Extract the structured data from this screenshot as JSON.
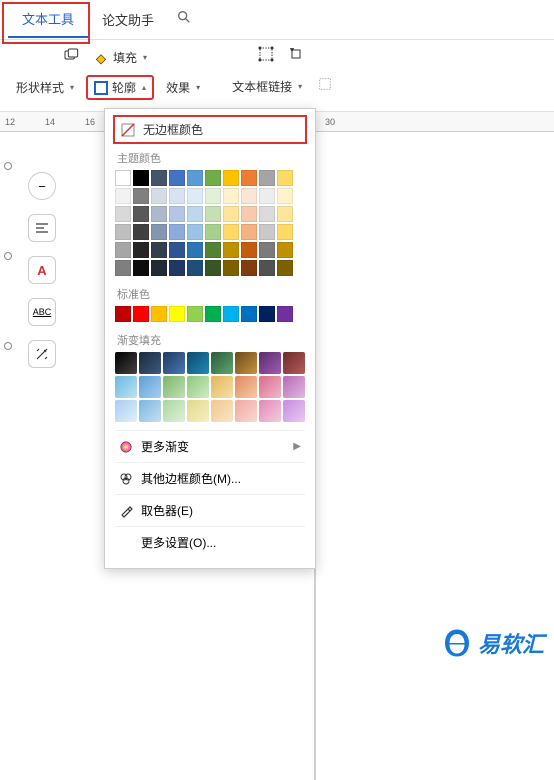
{
  "tabs": {
    "active": "文本工具",
    "other": "论文助手"
  },
  "toolbar": {
    "fill": "填充",
    "shape_style": "形状样式",
    "outline": "轮廓",
    "effect": "效果",
    "textbox_link": "文本框链接"
  },
  "ruler": [
    "12",
    "14",
    "16",
    "",
    "",
    "",
    "",
    "",
    "30"
  ],
  "dropdown": {
    "no_outline": "无边框颜色",
    "theme_colors": "主题颜色",
    "standard_colors": "标准色",
    "gradient_fill": "渐变填充",
    "more_gradients": "更多渐变",
    "other_border_colors": "其他边框颜色(M)...",
    "color_picker": "取色器(E)",
    "more_settings": "更多设置(O)..."
  },
  "colors": {
    "theme_row1": [
      "#ffffff",
      "#000000",
      "#44546a",
      "#4472c4",
      "#5b9bd5",
      "#70ad47",
      "#ffc000",
      "#ed7d31",
      "#a5a5a5",
      "#ffd966"
    ],
    "theme_shades": [
      [
        "#f2f2f2",
        "#808080",
        "#d6dce5",
        "#d9e2f3",
        "#deebf7",
        "#e2efd9",
        "#fff2cc",
        "#fbe5d6",
        "#ededed",
        "#fff2cc"
      ],
      [
        "#d9d9d9",
        "#595959",
        "#adb9ca",
        "#b4c6e7",
        "#bdd7ee",
        "#c5e0b3",
        "#ffe599",
        "#f7caac",
        "#dbdbdb",
        "#ffe599"
      ],
      [
        "#bfbfbf",
        "#404040",
        "#8496b0",
        "#8eaadb",
        "#9cc3e5",
        "#a8d08d",
        "#ffd966",
        "#f4b183",
        "#c9c9c9",
        "#ffd966"
      ],
      [
        "#a6a6a6",
        "#262626",
        "#323f4f",
        "#2f5496",
        "#2e75b5",
        "#538135",
        "#bf9000",
        "#c55a11",
        "#7b7b7b",
        "#bf9000"
      ],
      [
        "#7f7f7f",
        "#0d0d0d",
        "#222a35",
        "#1f3864",
        "#1f4e79",
        "#385623",
        "#7f6000",
        "#833c0b",
        "#525252",
        "#7f6000"
      ]
    ],
    "standard": [
      "#c00000",
      "#ff0000",
      "#ffc000",
      "#ffff00",
      "#92d050",
      "#00b050",
      "#00b0f0",
      "#0070c0",
      "#002060",
      "#7030a0"
    ],
    "gradients": [
      [
        "#000000,#434343",
        "#1b2a3a,#3d5a80",
        "#1f3a5f,#4a77b5",
        "#0b4a6f,#2389b5",
        "#2b5a3b,#60a56f",
        "#6b4a1b,#c7923e",
        "#5a2b6b,#a05bb5",
        "#6b2b2b,#b55b5b"
      ],
      [
        "#6bb7e0,#bde3f5",
        "#5aa0d8,#a8cdef",
        "#7bb56b,#c3e0b3",
        "#8bc77b,#d0ecc3",
        "#e0b75a,#f5e0a8",
        "#e08b5a,#f5c9a8",
        "#d86b8b,#f0b8c9",
        "#b56bb5,#e0b8e0"
      ],
      [
        "#a8cdef,#e0f0fa",
        "#7bb5e0,#c3e0f5",
        "#a8d6a0,#e0f0d8",
        "#e0d88b,#f5f0c3",
        "#f0c78b,#fae5c9",
        "#f0a8a0,#fad8d0",
        "#e08bb5,#f5c9e0",
        "#c78be0,#e8c9f5"
      ]
    ]
  },
  "side_tools": {
    "text_a": "A",
    "abc": "ABC"
  },
  "logo_text": "易软汇"
}
